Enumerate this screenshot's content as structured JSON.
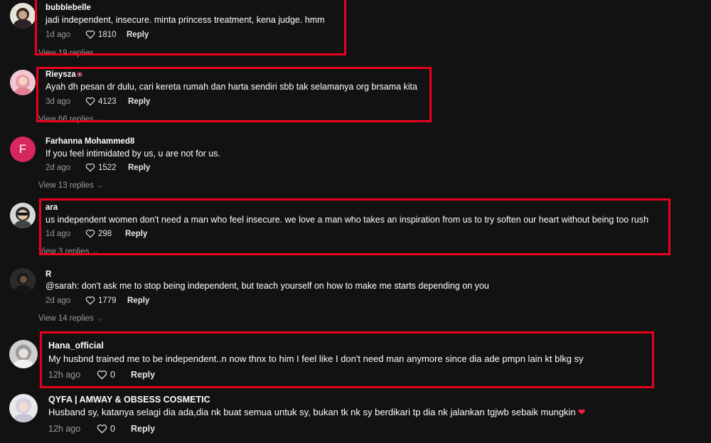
{
  "comments": [
    {
      "username": "bubblebelle",
      "text": "jadi independent, insecure. minta princess treatment, kena judge. hmm",
      "time": "1d ago",
      "likes": "1810",
      "reply_label": "Reply",
      "view_replies": "View 19 replies"
    },
    {
      "username": "Rieysza",
      "text": "Ayah dh pesan dr dulu, cari kereta rumah dan harta sendiri sbb tak selamanya org brsama kita",
      "time": "3d ago",
      "likes": "4123",
      "reply_label": "Reply",
      "view_replies": "View 66 replies"
    },
    {
      "username": "Farhanna Mohammed8",
      "avatar_letter": "F",
      "text": "If you feel intimidated by us, u are not for us.",
      "time": "2d ago",
      "likes": "1522",
      "reply_label": "Reply",
      "view_replies": "View 13 replies"
    },
    {
      "username": "ara",
      "text": "us independent women don't need a man who feel insecure. we love a man who takes an inspiration from us to try soften our heart without being too rush",
      "time": "1d ago",
      "likes": "298",
      "reply_label": "Reply",
      "view_replies": "View 3 replies"
    },
    {
      "username": "R",
      "text": "@sarah: don't ask me to stop being independent, but teach yourself on how to make me starts depending on you",
      "time": "2d ago",
      "likes": "1779",
      "reply_label": "Reply",
      "view_replies": "View 14 replies"
    },
    {
      "username": "Hana_official",
      "text": "My husbnd trained me to be independent..n now thnx to him I feel like I don't need man anymore since dia ade pmpn lain kt blkg sy",
      "time": "12h ago",
      "likes": "0",
      "reply_label": "Reply"
    },
    {
      "username": "QYFA | AMWAY & OBSESS COSMETIC",
      "text": "Husband sy, katanya selagi dia ada,dia nk buat semua untuk sy, bukan tk nk sy berdikari tp dia nk jalankan tgjwb sebaik mungkin",
      "time": "12h ago",
      "likes": "0",
      "reply_label": "Reply"
    }
  ],
  "colors": {
    "highlight": "#e8001f",
    "background": "#121212",
    "muted": "#9a9a9a"
  }
}
